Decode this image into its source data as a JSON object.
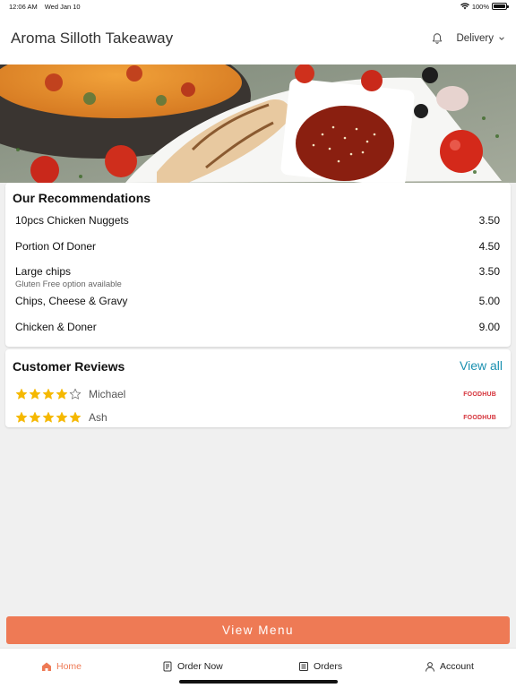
{
  "status": {
    "time": "12:06 AM",
    "date": "Wed Jan 10",
    "battery": "100%",
    "battery_level": 1.0
  },
  "header": {
    "title": "Aroma Silloth Takeaway",
    "order_type": "Delivery"
  },
  "recommendations": {
    "title": "Our Recommendations",
    "items": [
      {
        "name": "10pcs Chicken Nuggets",
        "price": "3.50",
        "note": ""
      },
      {
        "name": "Portion Of Doner",
        "price": "4.50",
        "note": ""
      },
      {
        "name": "Large chips",
        "price": "3.50",
        "note": "Gluten Free option available"
      },
      {
        "name": "Chips, Cheese & Gravy",
        "price": "5.00",
        "note": ""
      },
      {
        "name": "Chicken & Doner",
        "price": "9.00",
        "note": ""
      }
    ]
  },
  "reviews": {
    "title": "Customer Reviews",
    "view_all": "View all",
    "items": [
      {
        "name": "Michael",
        "rating": 4,
        "source": "FOODHUB"
      },
      {
        "name": "Ash",
        "rating": 5,
        "source": "FOODHUB"
      }
    ]
  },
  "view_menu_label": "View Menu",
  "tabs": [
    {
      "label": "Home",
      "icon": "home-icon",
      "active": true
    },
    {
      "label": "Order Now",
      "icon": "order-icon",
      "active": false
    },
    {
      "label": "Orders",
      "icon": "orders-icon",
      "active": false
    },
    {
      "label": "Account",
      "icon": "account-icon",
      "active": false
    }
  ],
  "colors": {
    "accent": "#ee7a55",
    "link": "#1a90b0",
    "star": "#f5b800",
    "source_brand": "#d5323a"
  }
}
